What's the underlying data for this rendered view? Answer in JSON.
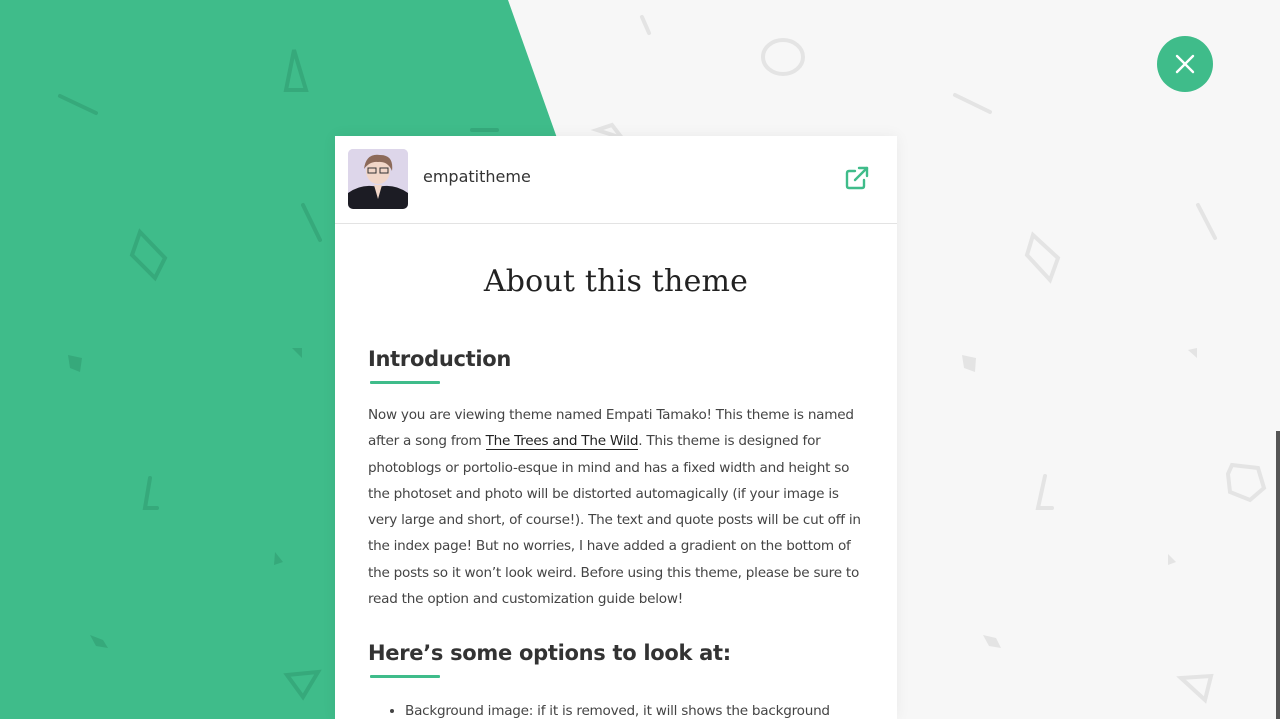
{
  "colors": {
    "accent": "#3fbc8a",
    "background": "#f7f7f7"
  },
  "header": {
    "username": "empatitheme",
    "avatar_icon": "avatar-photo",
    "external_link_icon": "external-link-icon"
  },
  "close_icon": "close-icon",
  "content": {
    "title": "About this theme",
    "intro_heading": "Introduction",
    "intro_text_1": "Now you are viewing theme named Empati Tamako! This theme is named after a song from ",
    "intro_link": "The Trees and The Wild",
    "intro_text_2": ". This theme is designed for photoblogs or portolio-esque in mind and has a fixed width and height so the photoset and photo will be distorted automagically (if your image is very large and short, of course!). The text and quote posts will be cut off in the index page! But no worries, I have added a gradient on the bottom of the posts so it won’t look weird. Before using this theme, please be sure to read the option and customization guide below!",
    "options_heading": "Here’s some options to look at:",
    "options": [
      "Background image: if it is removed, it will shows the background"
    ]
  }
}
